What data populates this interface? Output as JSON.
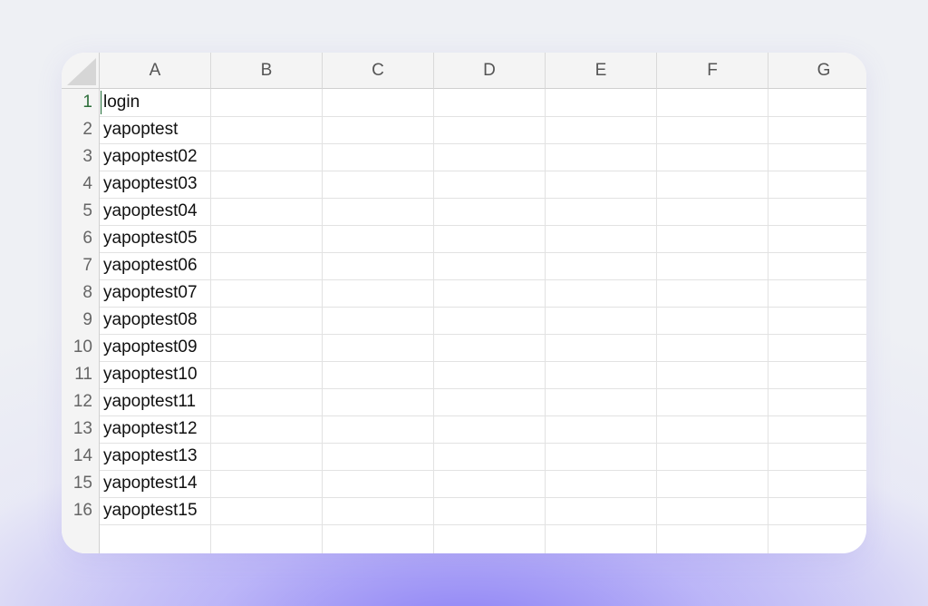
{
  "spreadsheet": {
    "columns": [
      "A",
      "B",
      "C",
      "D",
      "E",
      "F",
      "G"
    ],
    "rows": [
      {
        "num": "1",
        "a": "login"
      },
      {
        "num": "2",
        "a": "yapoptest"
      },
      {
        "num": "3",
        "a": "yapoptest02"
      },
      {
        "num": "4",
        "a": "yapoptest03"
      },
      {
        "num": "5",
        "a": "yapoptest04"
      },
      {
        "num": "6",
        "a": "yapoptest05"
      },
      {
        "num": "7",
        "a": "yapoptest06"
      },
      {
        "num": "8",
        "a": "yapoptest07"
      },
      {
        "num": "9",
        "a": "yapoptest08"
      },
      {
        "num": "10",
        "a": "yapoptest09"
      },
      {
        "num": "11",
        "a": "yapoptest10"
      },
      {
        "num": "12",
        "a": "yapoptest11"
      },
      {
        "num": "13",
        "a": "yapoptest12"
      },
      {
        "num": "14",
        "a": "yapoptest13"
      },
      {
        "num": "15",
        "a": "yapoptest14"
      },
      {
        "num": "16",
        "a": "yapoptest15"
      }
    ],
    "active_cell": "A1"
  },
  "colors": {
    "active_accent": "#2c6e3a",
    "background_glow": "#8c80f5"
  }
}
